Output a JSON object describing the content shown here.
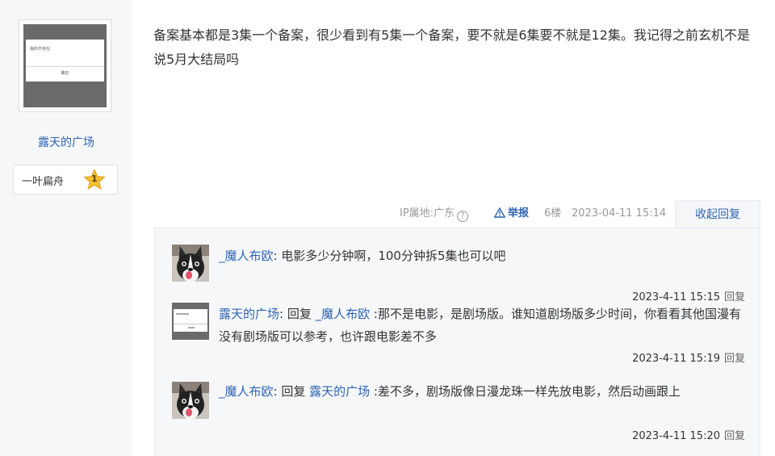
{
  "author": {
    "avatar_dialog_text": "我的不存在",
    "avatar_dialog_ok": "确定",
    "name": "露天的广场",
    "badge_name": "一叶扁舟",
    "badge_level": "1"
  },
  "post": {
    "text": "备案基本都是3集一个备案，很少看到有5集一个备案，要不就是6集要不就是12集。我记得之前玄机不是说5月大结局吗"
  },
  "tail": {
    "ip_location": "IP属地:广东",
    "help_icon": "?",
    "report_label": "举报",
    "floor": "6楼",
    "time": "2023-04-11 15:14",
    "fold_replies": "收起回复"
  },
  "replies": [
    {
      "avatar_icon": "husky-dog-avatar",
      "author": "_魔人布欧",
      "separator": ":",
      "reply_word": "",
      "reply_to": "",
      "content": " 电影多少分钟啊，100分钟拆5集也可以吧",
      "time": "2023-4-11 15:15",
      "reply_button": "回复"
    },
    {
      "avatar_icon": "dialog-screenshot-avatar",
      "author": "露天的广场",
      "separator": ":",
      "reply_word": " 回复 ",
      "reply_to": "_魔人布欧",
      "content": " :那不是电影，是剧场版。谁知道剧场版多少时间，你看看其他国漫有没有剧场版可以参考，也许跟电影差不多",
      "time": "2023-4-11 15:19",
      "reply_button": "回复"
    },
    {
      "avatar_icon": "husky-dog-avatar",
      "author": "_魔人布欧",
      "separator": ":",
      "reply_word": " 回复 ",
      "reply_to": "露天的广场",
      "content": " :差不多，剧场版像日漫龙珠一样先放电影，然后动画跟上",
      "time": "2023-4-11 15:20",
      "reply_button": "回复"
    }
  ],
  "colors": {
    "link_blue": "#2d64b3",
    "panel_bg": "#f6f7f9",
    "star_gold": "#f6c12e"
  }
}
